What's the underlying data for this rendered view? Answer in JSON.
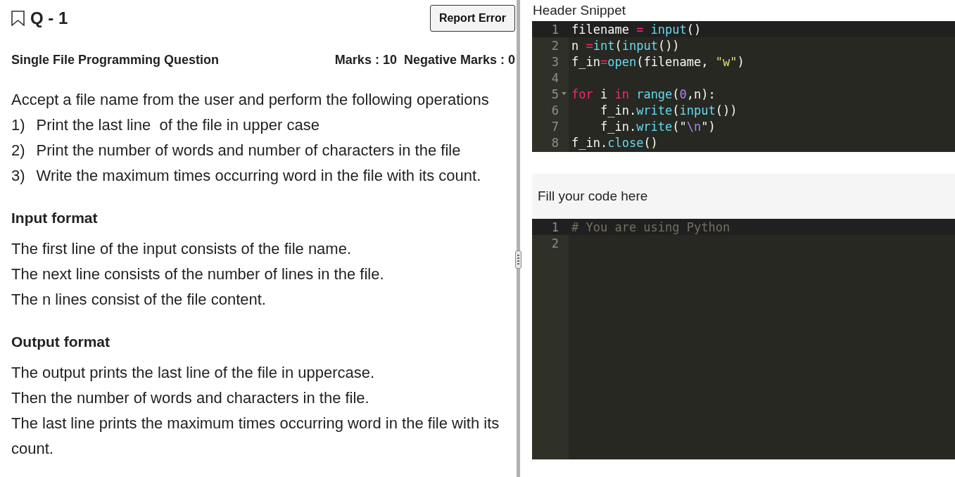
{
  "question": {
    "bookmarked": false,
    "number": "Q - 1",
    "report_button": "Report Error",
    "type": "Single File Programming Question",
    "marks": "Marks : 10",
    "negative_marks": "Negative Marks : 0"
  },
  "description": {
    "intro": "Accept a file name from the user and perform the following operations",
    "steps": [
      {
        "marker": "1)",
        "text": "Print the last line  of the file in upper case"
      },
      {
        "marker": "2)",
        "text": "Print the number of words and number of characters in the file"
      },
      {
        "marker": "3)",
        "text": "Write the maximum times occurring word in the file with its count."
      }
    ]
  },
  "sections": [
    {
      "heading": "Input format",
      "lines": [
        "The first line of the input consists of the file name.",
        "The next line consists of the number of lines in the file.",
        "The n lines consist of the file content."
      ]
    },
    {
      "heading": "Output format",
      "lines": [
        "The output prints the last line of the file in uppercase.",
        "Then the number of words and characters in the file.",
        "The last line prints the maximum times occurring word in the file with its count."
      ]
    }
  ],
  "header_snippet": {
    "title": "Header Snippet",
    "lines": [
      {
        "number": "1",
        "active": true,
        "foldable": false,
        "tokens": [
          {
            "t": "filename ",
            "kind": "plain"
          },
          {
            "t": "= ",
            "kind": "operator"
          },
          {
            "t": "input",
            "kind": "builtin"
          },
          {
            "t": "()",
            "kind": "plain"
          }
        ]
      },
      {
        "number": "2",
        "active": false,
        "foldable": false,
        "tokens": [
          {
            "t": "n ",
            "kind": "plain"
          },
          {
            "t": "=",
            "kind": "operator"
          },
          {
            "t": "int",
            "kind": "builtin"
          },
          {
            "t": "(",
            "kind": "plain"
          },
          {
            "t": "input",
            "kind": "builtin"
          },
          {
            "t": "())",
            "kind": "plain"
          }
        ]
      },
      {
        "number": "3",
        "active": false,
        "foldable": false,
        "tokens": [
          {
            "t": "f_in",
            "kind": "plain"
          },
          {
            "t": "=",
            "kind": "operator"
          },
          {
            "t": "open",
            "kind": "builtin"
          },
          {
            "t": "(filename, ",
            "kind": "plain"
          },
          {
            "t": "\"w\"",
            "kind": "string"
          },
          {
            "t": ")",
            "kind": "plain"
          }
        ]
      },
      {
        "number": "4",
        "active": false,
        "foldable": false
      },
      {
        "number": "5",
        "active": false,
        "foldable": true,
        "tokens": [
          {
            "t": "for",
            "kind": "keyword"
          },
          {
            "t": " i ",
            "kind": "plain"
          },
          {
            "t": "in ",
            "kind": "keyword"
          },
          {
            "t": "range",
            "kind": "builtin"
          },
          {
            "t": "(",
            "kind": "plain"
          },
          {
            "t": "0",
            "kind": "number"
          },
          {
            "t": ",n):",
            "kind": "plain"
          }
        ]
      },
      {
        "number": "6",
        "active": false,
        "foldable": false,
        "tokens": [
          {
            "t": "    f_in.",
            "kind": "plain"
          },
          {
            "t": "write",
            "kind": "builtin"
          },
          {
            "t": "(",
            "kind": "plain"
          },
          {
            "t": "input",
            "kind": "builtin"
          },
          {
            "t": "())",
            "kind": "plain"
          }
        ]
      },
      {
        "number": "7",
        "active": false,
        "foldable": false,
        "tokens": [
          {
            "t": "    f_in.",
            "kind": "plain"
          },
          {
            "t": "write",
            "kind": "builtin"
          },
          {
            "t": "(\"",
            "kind": "plain"
          },
          {
            "t": "\\n",
            "kind": "number"
          },
          {
            "t": "\")",
            "kind": "plain"
          }
        ]
      },
      {
        "number": "8",
        "active": false,
        "foldable": false,
        "tokens": [
          {
            "t": "f_in.",
            "kind": "plain"
          },
          {
            "t": "close",
            "kind": "builtin"
          },
          {
            "t": "()",
            "kind": "plain"
          }
        ]
      }
    ]
  },
  "answer": {
    "title": "Fill your code here",
    "lines": [
      {
        "number": "1",
        "active": true,
        "foldable": false,
        "tokens": [
          {
            "t": "# You are using Python",
            "kind": "comment"
          }
        ]
      },
      {
        "number": "2",
        "active": false,
        "foldable": false
      }
    ]
  }
}
